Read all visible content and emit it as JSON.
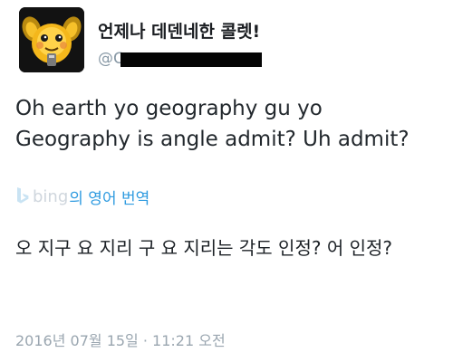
{
  "tweet": {
    "display_name": "언제나 데덴네한 콜렛!",
    "handle": "@C",
    "avatar_icon": "dedenne-icon",
    "text_line1": "Oh earth yo geography gu yo",
    "text_line2": "Geography is angle admit? Uh admit?",
    "translation": {
      "bing_word": "bing",
      "label": "의 영어 번역",
      "icon": "bing-icon"
    },
    "translated_text": "오 지구 요 지리 구 요 지리는 각도 인정? 어 인정?",
    "timestamp": "2016년 07월 15일 · 11:21 오전"
  },
  "colors": {
    "link_blue": "#2f9be0",
    "muted_gray": "#9aa6b0",
    "text_dark": "#22282d"
  }
}
